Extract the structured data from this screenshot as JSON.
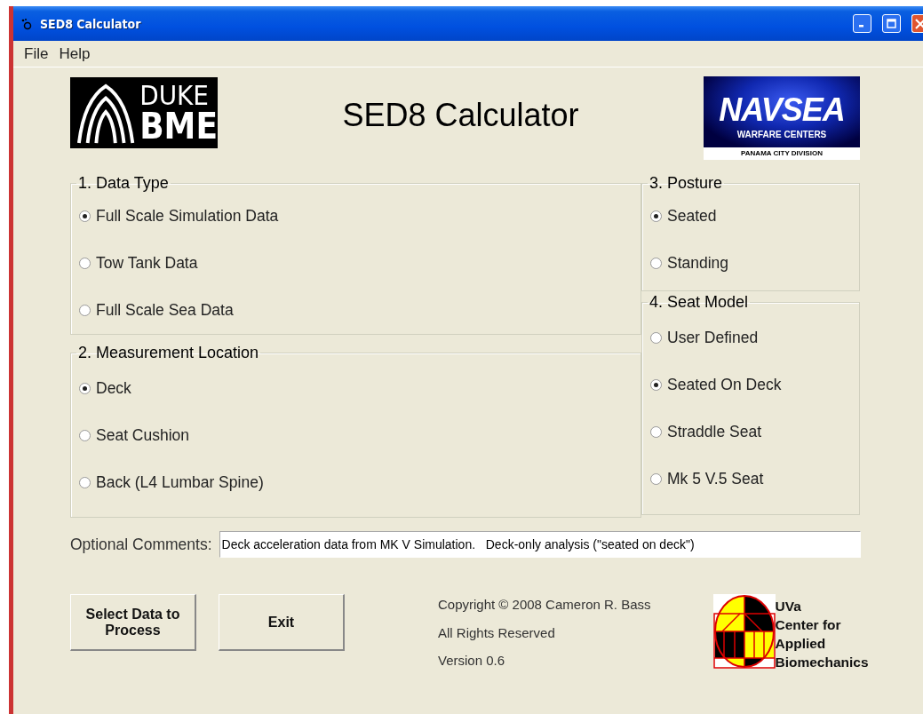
{
  "window": {
    "title": "SED8 Calculator"
  },
  "menu": [
    {
      "label": "File"
    },
    {
      "label": "Help"
    }
  ],
  "header": {
    "left_logo": {
      "lines": [
        "DUKE",
        "BME"
      ]
    },
    "title": "SED8 Calculator",
    "right_logo": {
      "name": "NAVSEA",
      "subtitle": "WARFARE CENTERS",
      "division": "PANAMA CITY DIVISION"
    }
  },
  "panels": {
    "left": [
      {
        "title": "1. Data Type",
        "options": [
          {
            "label": "Full Scale Simulation Data",
            "selected": true
          },
          {
            "label": "Tow Tank Data",
            "selected": false
          },
          {
            "label": "Full Scale Sea Data",
            "selected": false
          }
        ]
      },
      {
        "title": "2. Measurement Location",
        "options": [
          {
            "label": "Deck",
            "selected": true
          },
          {
            "label": "Seat Cushion",
            "selected": false
          },
          {
            "label": "Back (L4 Lumbar Spine)",
            "selected": false
          }
        ]
      }
    ],
    "right": [
      {
        "title": "3. Posture",
        "options": [
          {
            "label": "Seated",
            "selected": true
          },
          {
            "label": "Standing",
            "selected": false
          }
        ]
      },
      {
        "title": "4. Seat Model",
        "options": [
          {
            "label": "User Defined",
            "selected": false
          },
          {
            "label": "Seated On Deck",
            "selected": true
          },
          {
            "label": "Straddle Seat",
            "selected": false
          },
          {
            "label": "Mk 5 V.5 Seat",
            "selected": false
          }
        ]
      }
    ]
  },
  "comments": {
    "label": "Optional Comments:",
    "value": "Deck acceleration data from MK V Simulation.   Deck-only analysis (\"seated on deck\")"
  },
  "buttons": [
    {
      "label": "Select Data to Process"
    },
    {
      "label": "Exit"
    }
  ],
  "credits": [
    "Copyright © 2008 Cameron R. Bass",
    "All Rights Reserved",
    "Version 0.6"
  ],
  "lab": {
    "lines": [
      "UVa",
      "Center for",
      "Applied",
      "Biomechanics"
    ]
  }
}
